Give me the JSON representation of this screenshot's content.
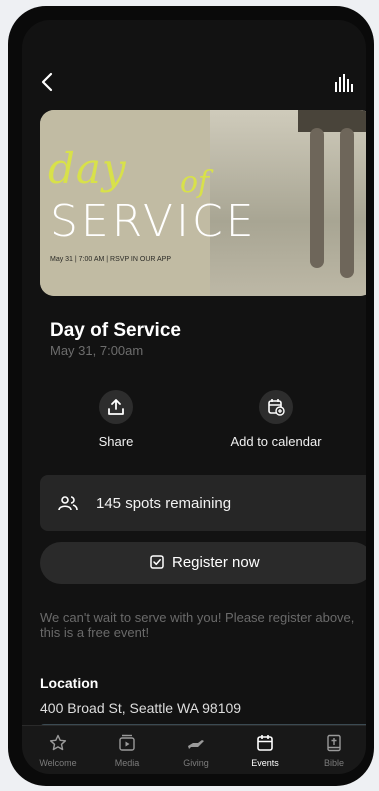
{
  "header": {
    "back_icon": "chevron-left-icon",
    "stats_icon": "bar-chart-icon"
  },
  "hero": {
    "script_word_1": "day",
    "script_word_2": "of",
    "main_word": "SERVICE",
    "subline": "May 31 | 7:00 AM | RSVP IN OUR APP",
    "accent_color": "#d8e14a"
  },
  "event": {
    "title": "Day of Service",
    "date": "May 31, 7:00am"
  },
  "actions": [
    {
      "label": "Share",
      "icon": "share-icon"
    },
    {
      "label": "Add to calendar",
      "icon": "calendar-add-icon"
    }
  ],
  "spots": {
    "text": "145 spots remaining",
    "icon": "people-icon"
  },
  "register": {
    "label": "Register now",
    "icon": "checkbox-icon"
  },
  "description": "We can't wait to serve with you! Please register above, this is a free event!",
  "location": {
    "heading": "Location",
    "address": "400 Broad St, Seattle WA 98109"
  },
  "tabs": [
    {
      "label": "Welcome",
      "icon": "star-icon",
      "active": false
    },
    {
      "label": "Media",
      "icon": "media-icon",
      "active": false
    },
    {
      "label": "Giving",
      "icon": "giving-icon",
      "active": false
    },
    {
      "label": "Events",
      "icon": "events-icon",
      "active": true
    },
    {
      "label": "Bible",
      "icon": "bible-icon",
      "active": false
    }
  ]
}
